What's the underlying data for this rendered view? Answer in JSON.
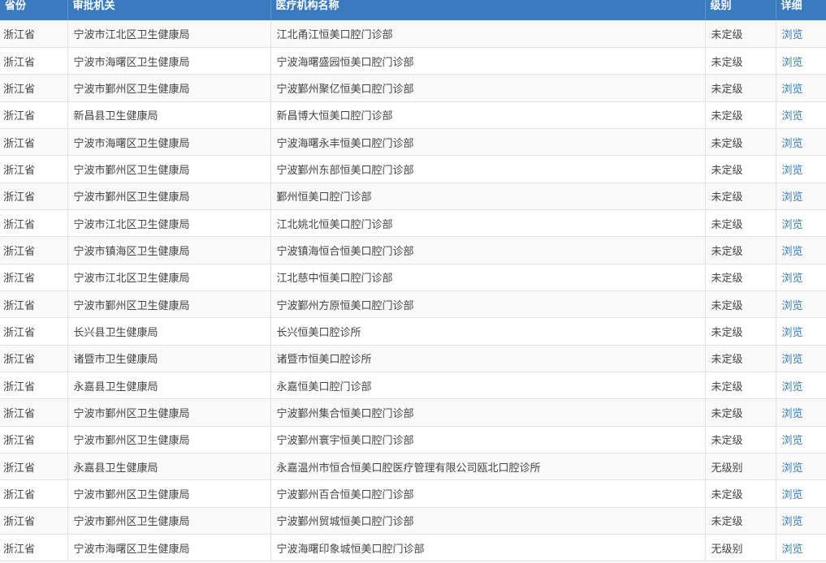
{
  "table": {
    "headers": [
      "省份",
      "审批机关",
      "医疗机构名称",
      "级别",
      "详细"
    ],
    "rows": [
      {
        "province": "浙江省",
        "authority": "宁波市江北区卫生健康局",
        "institution": "江北甬江恒美口腔门诊部",
        "level": "未定级",
        "detail": "浏览"
      },
      {
        "province": "浙江省",
        "authority": "宁波市海曙区卫生健康局",
        "institution": "宁波海曙盛园恒美口腔门诊部",
        "level": "未定级",
        "detail": "浏览"
      },
      {
        "province": "浙江省",
        "authority": "宁波市鄞州区卫生健康局",
        "institution": "宁波鄞州聚亿恒美口腔门诊部",
        "level": "未定级",
        "detail": "浏览"
      },
      {
        "province": "浙江省",
        "authority": "新昌县卫生健康局",
        "institution": "新昌博大恒美口腔门诊部",
        "level": "未定级",
        "detail": "浏览"
      },
      {
        "province": "浙江省",
        "authority": "宁波市海曙区卫生健康局",
        "institution": "宁波海曙永丰恒美口腔门诊部",
        "level": "未定级",
        "detail": "浏览"
      },
      {
        "province": "浙江省",
        "authority": "宁波市鄞州区卫生健康局",
        "institution": "宁波鄞州东部恒美口腔门诊部",
        "level": "未定级",
        "detail": "浏览"
      },
      {
        "province": "浙江省",
        "authority": "宁波市鄞州区卫生健康局",
        "institution": "鄞州恒美口腔门诊部",
        "level": "未定级",
        "detail": "浏览"
      },
      {
        "province": "浙江省",
        "authority": "宁波市江北区卫生健康局",
        "institution": "江北姚北恒美口腔门诊部",
        "level": "未定级",
        "detail": "浏览"
      },
      {
        "province": "浙江省",
        "authority": "宁波市镇海区卫生健康局",
        "institution": "宁波镇海恒合恒美口腔门诊部",
        "level": "未定级",
        "detail": "浏览"
      },
      {
        "province": "浙江省",
        "authority": "宁波市江北区卫生健康局",
        "institution": "江北慈中恒美口腔门诊部",
        "level": "未定级",
        "detail": "浏览"
      },
      {
        "province": "浙江省",
        "authority": "宁波市鄞州区卫生健康局",
        "institution": "宁波鄞州方原恒美口腔门诊部",
        "level": "未定级",
        "detail": "浏览"
      },
      {
        "province": "浙江省",
        "authority": "长兴县卫生健康局",
        "institution": "长兴恒美口腔诊所",
        "level": "未定级",
        "detail": "浏览"
      },
      {
        "province": "浙江省",
        "authority": "诸暨市卫生健康局",
        "institution": "诸暨市恒美口腔诊所",
        "level": "未定级",
        "detail": "浏览"
      },
      {
        "province": "浙江省",
        "authority": "永嘉县卫生健康局",
        "institution": "永嘉恒美口腔门诊部",
        "level": "未定级",
        "detail": "浏览"
      },
      {
        "province": "浙江省",
        "authority": "宁波市鄞州区卫生健康局",
        "institution": "宁波鄞州集合恒美口腔门诊部",
        "level": "未定级",
        "detail": "浏览"
      },
      {
        "province": "浙江省",
        "authority": "宁波市鄞州区卫生健康局",
        "institution": "宁波鄞州寰宇恒美口腔门诊部",
        "level": "未定级",
        "detail": "浏览"
      },
      {
        "province": "浙江省",
        "authority": "永嘉县卫生健康局",
        "institution": "永嘉温州市恒合恒美口腔医疗管理有限公司瓯北口腔诊所",
        "level": "无级别",
        "detail": "浏览"
      },
      {
        "province": "浙江省",
        "authority": "宁波市鄞州区卫生健康局",
        "institution": "宁波鄞州百合恒美口腔门诊部",
        "level": "未定级",
        "detail": "浏览"
      },
      {
        "province": "浙江省",
        "authority": "宁波市鄞州区卫生健康局",
        "institution": "宁波鄞州贸城恒美口腔门诊部",
        "level": "未定级",
        "detail": "浏览"
      },
      {
        "province": "浙江省",
        "authority": "宁波市海曙区卫生健康局",
        "institution": "宁波海曙印象城恒美口腔门诊部",
        "level": "无级别",
        "detail": "浏览"
      }
    ]
  },
  "colors": {
    "header_bg": "#3a7bbf",
    "link": "#3a7bbf",
    "row_alt_bg": "#f9f9f9"
  }
}
